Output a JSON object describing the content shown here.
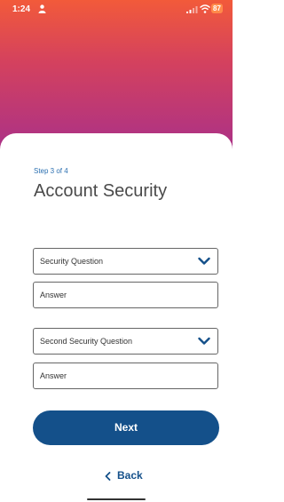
{
  "status_bar": {
    "time": "1:24",
    "battery": "87"
  },
  "form": {
    "step": "Step 3 of 4",
    "title": "Account Security",
    "question1_placeholder": "Security Question",
    "answer1_placeholder": "Answer",
    "question2_placeholder": "Second Security Question",
    "answer2_placeholder": "Answer"
  },
  "actions": {
    "next_label": "Next",
    "back_label": "Back"
  },
  "colors": {
    "hero_top": "#f25a3a",
    "hero_bottom": "#a8308a",
    "primary": "#14508a",
    "step_text": "#2a6fb0"
  },
  "icons": [
    "person-icon",
    "signal-icon",
    "wifi-icon",
    "chevron-down-icon",
    "chevron-left-icon"
  ]
}
